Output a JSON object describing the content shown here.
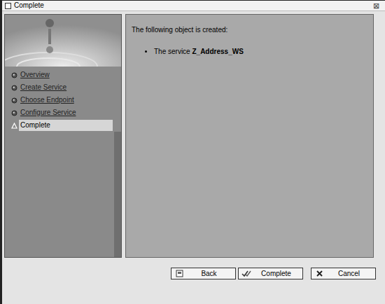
{
  "window": {
    "title": "Complete",
    "close": "⊠"
  },
  "steps": [
    {
      "label": "Overview",
      "selected": false
    },
    {
      "label": "Create Service",
      "selected": false
    },
    {
      "label": "Choose Endpoint",
      "selected": false
    },
    {
      "label": "Configure Service",
      "selected": false
    },
    {
      "label": "Complete",
      "selected": true
    }
  ],
  "content": {
    "heading": "The following object is created:",
    "items": [
      {
        "prefix": "The service ",
        "name": "Z_Address_WS"
      }
    ]
  },
  "buttons": [
    {
      "label": "Back"
    },
    {
      "label": "Complete"
    },
    {
      "label": "Cancel"
    }
  ]
}
